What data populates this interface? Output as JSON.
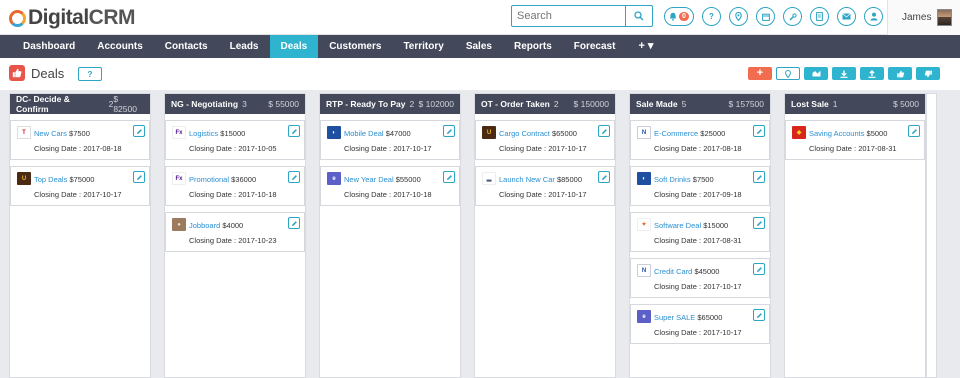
{
  "brand": {
    "name_a": "Digital",
    "name_b": "CRM"
  },
  "search": {
    "placeholder": "Search"
  },
  "header": {
    "notification_count": "0",
    "user_name": "James"
  },
  "header_icons": [
    "bell-icon",
    "help-icon",
    "location-icon",
    "calendar-icon",
    "wrench-icon",
    "document-icon",
    "mail-icon",
    "user-icon"
  ],
  "nav": [
    "Dashboard",
    "Accounts",
    "Contacts",
    "Leads",
    "Deals",
    "Customers",
    "Territory",
    "Sales",
    "Reports",
    "Forecast"
  ],
  "nav_active": "Deals",
  "nav_more": "+ ▾",
  "page": {
    "title": "Deals",
    "help": "?",
    "add": "+"
  },
  "toolbar_icons": [
    "add-icon",
    "location-icon",
    "chart-icon",
    "download-icon",
    "upload-icon",
    "thumbs-up-icon",
    "thumbs-down-icon"
  ],
  "colors": {
    "nav_bg": "#43495a",
    "active_tab": "#2eb4cf",
    "accent": "#2da5c4",
    "link": "#2b8fd0",
    "add_button": "#f26c4f"
  },
  "columns": [
    {
      "name": "DC- Decide & Confirm",
      "count": "2",
      "total": "$ 82500",
      "cards": [
        {
          "title": "New Cars",
          "amount": "$7500",
          "date": "Closing Date : 2017-08-18",
          "logo": "toyota"
        },
        {
          "title": "Top Deals",
          "amount": "$75000",
          "date": "Closing Date : 2017-10-17",
          "logo": "ups"
        }
      ]
    },
    {
      "name": "NG - Negotiating",
      "count": "3",
      "total": "$ 55000",
      "cards": [
        {
          "title": "Logistics",
          "amount": "$15000",
          "date": "Closing Date : 2017-10-05",
          "logo": "fedex"
        },
        {
          "title": "Promotional",
          "amount": "$36000",
          "date": "Closing Date : 2017-10-18",
          "logo": "fedex"
        },
        {
          "title": "Jobboard",
          "amount": "$4000",
          "date": "Closing Date : 2017-10-23",
          "logo": "person"
        }
      ]
    },
    {
      "name": "RTP - Ready To Pay",
      "count": "2",
      "total": "$ 102000",
      "cards": [
        {
          "title": "Mobile Deal",
          "amount": "$47000",
          "date": "Closing Date : 2017-10-17",
          "logo": "pepsi"
        },
        {
          "title": "New Year Deal",
          "amount": "$55000",
          "date": "Closing Date : 2017-10-18",
          "logo": "ebay"
        }
      ]
    },
    {
      "name": "OT - Order Taken",
      "count": "2",
      "total": "$ 150000",
      "cards": [
        {
          "title": "Cargo Contract",
          "amount": "$65000",
          "date": "Closing Date : 2017-10-17",
          "logo": "ups"
        },
        {
          "title": "Launch New Car",
          "amount": "$85000",
          "date": "Closing Date : 2017-10-17",
          "logo": "car"
        }
      ]
    },
    {
      "name": "Sale Made",
      "count": "5",
      "total": "$ 157500",
      "cards": [
        {
          "title": "E-Commerce",
          "amount": "$25000",
          "date": "Closing Date : 2017-08-18",
          "logo": "nyse"
        },
        {
          "title": "Soft Drinks",
          "amount": "$7500",
          "date": "Closing Date : 2017-09-18",
          "logo": "pepsi"
        },
        {
          "title": "Software Deal",
          "amount": "$15000",
          "date": "Closing Date : 2017-08-31",
          "logo": "windows"
        },
        {
          "title": "Credit Card",
          "amount": "$45000",
          "date": "Closing Date : 2017-10-17",
          "logo": "nyse"
        },
        {
          "title": "Super SALE",
          "amount": "$65000",
          "date": "Closing Date : 2017-10-17",
          "logo": "ebay"
        }
      ]
    },
    {
      "name": "Lost Sale",
      "count": "1",
      "total": "$ 5000",
      "cards": [
        {
          "title": "Saving Accounts",
          "amount": "$5000",
          "date": "Closing Date : 2017-08-31",
          "logo": "shell"
        }
      ]
    }
  ]
}
